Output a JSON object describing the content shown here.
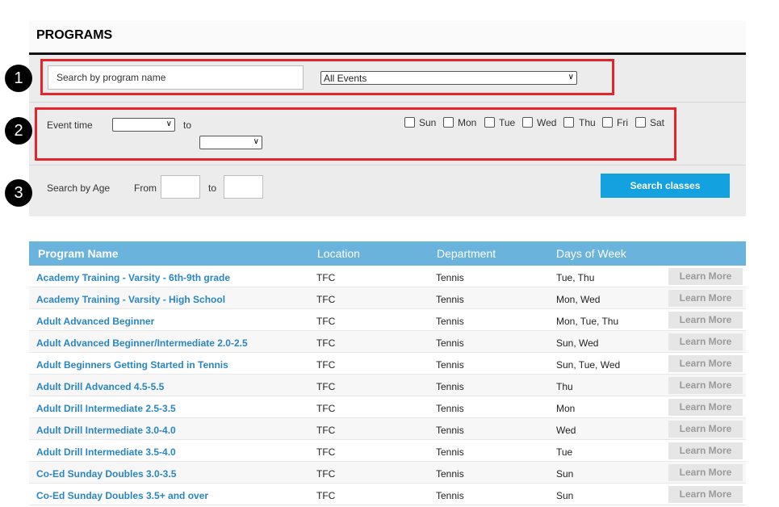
{
  "header": {
    "title": "PROGRAMS"
  },
  "search": {
    "placeholder": "Search by program name",
    "events_select": "All Events",
    "event_time_label": "Event time",
    "to_label": "to",
    "time_from": "",
    "time_to": "",
    "days": [
      "Sun",
      "Mon",
      "Tue",
      "Wed",
      "Thu",
      "Fri",
      "Sat"
    ],
    "age_label": "Search by Age",
    "from_label": "From",
    "age_to_label": "to",
    "age_from": "",
    "age_to": "",
    "search_button": "Search classes"
  },
  "annotations": {
    "badge1": "1",
    "badge2": "2",
    "badge3": "3"
  },
  "table": {
    "headers": [
      "Program Name",
      "Location",
      "Department",
      "Days of Week"
    ],
    "learn_more": "Learn More",
    "rows": [
      {
        "name": "Academy Training - Varsity - 6th-9th grade",
        "location": "TFC",
        "department": "Tennis",
        "days": "Tue, Thu"
      },
      {
        "name": "Academy Training - Varsity - High School",
        "location": "TFC",
        "department": "Tennis",
        "days": "Mon, Wed"
      },
      {
        "name": "Adult Advanced Beginner",
        "location": "TFC",
        "department": "Tennis",
        "days": "Mon, Tue, Thu"
      },
      {
        "name": "Adult Advanced Beginner/Intermediate 2.0-2.5",
        "location": "TFC",
        "department": "Tennis",
        "days": "Sun, Wed"
      },
      {
        "name": "Adult Beginners Getting Started in Tennis",
        "location": "TFC",
        "department": "Tennis",
        "days": "Sun, Tue, Wed"
      },
      {
        "name": "Adult Drill Advanced 4.5-5.5",
        "location": "TFC",
        "department": "Tennis",
        "days": "Thu"
      },
      {
        "name": "Adult Drill Intermediate 2.5-3.5",
        "location": "TFC",
        "department": "Tennis",
        "days": "Mon"
      },
      {
        "name": "Adult Drill Intermediate 3.0-4.0",
        "location": "TFC",
        "department": "Tennis",
        "days": "Wed"
      },
      {
        "name": "Adult Drill Intermediate 3.5-4.0",
        "location": "TFC",
        "department": "Tennis",
        "days": "Tue"
      },
      {
        "name": "Co-Ed Sunday Doubles 3.0-3.5",
        "location": "TFC",
        "department": "Tennis",
        "days": "Sun"
      },
      {
        "name": "Co-Ed Sunday Doubles 3.5+ and over",
        "location": "TFC",
        "department": "Tennis",
        "days": "Sun"
      }
    ]
  },
  "colors": {
    "header_bar": "#6ab3dc",
    "link": "#2a86c0",
    "button": "#13a1e0",
    "annotation_box": "#e3262b"
  }
}
